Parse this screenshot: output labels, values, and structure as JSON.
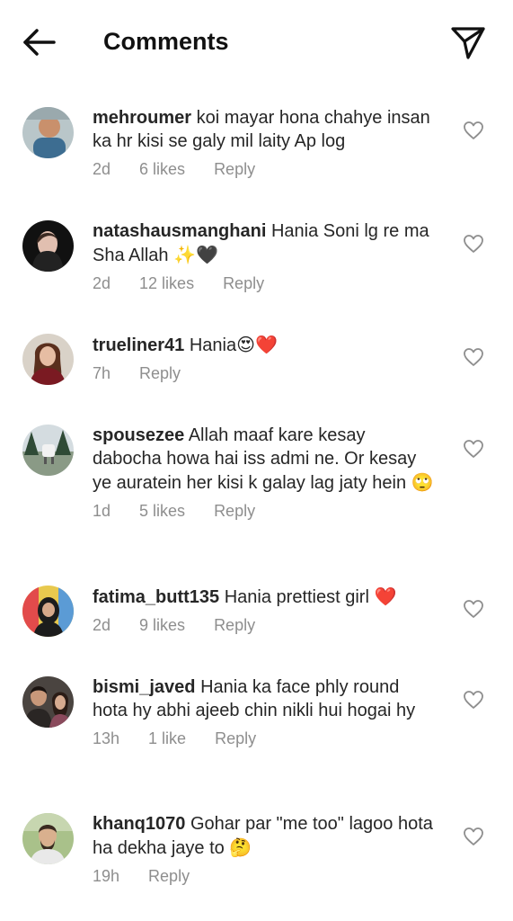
{
  "header": {
    "title": "Comments",
    "back_icon": "arrow-left-icon",
    "send_icon": "paper-plane-icon"
  },
  "comments": [
    {
      "username": "mehroumer",
      "text": "koi mayar hona chahye insan ka hr kisi se galy mil laity Ap log",
      "time": "2d",
      "likes": "6 likes",
      "reply": "Reply",
      "emoji": ""
    },
    {
      "username": "natashausmanghani",
      "text": "Hania Soni lg re ma Sha Allah",
      "time": "2d",
      "likes": "12 likes",
      "reply": "Reply",
      "emoji": "✨🖤"
    },
    {
      "username": "trueliner41",
      "text": "Hania",
      "time": "7h",
      "likes": "",
      "reply": "Reply",
      "emoji": "😍❤️"
    },
    {
      "username": "spousezee",
      "text": "Allah maaf kare kesay dabocha howa hai iss admi ne. Or kesay ye auratein her kisi k galay lag jaty hein",
      "time": "1d",
      "likes": "5 likes",
      "reply": "Reply",
      "emoji": "🙄"
    },
    {
      "username": "fatima_butt135",
      "text": "Hania prettiest girl",
      "time": "2d",
      "likes": "9 likes",
      "reply": "Reply",
      "emoji": "❤️"
    },
    {
      "username": "bismi_javed",
      "text": "Hania ka face phly round hota hy abhi ajeeb chin nikli hui hogai hy",
      "time": "13h",
      "likes": "1 like",
      "reply": "Reply",
      "emoji": ""
    },
    {
      "username": "khanq1070",
      "text": "Gohar par \"me too\" lagoo hota ha dekha jaye to",
      "time": "19h",
      "likes": "",
      "reply": "Reply",
      "emoji": "🤔"
    }
  ],
  "colors": {
    "text": "#262626",
    "meta": "#8e8e8e",
    "heart_outline": "#8e8e8e"
  }
}
